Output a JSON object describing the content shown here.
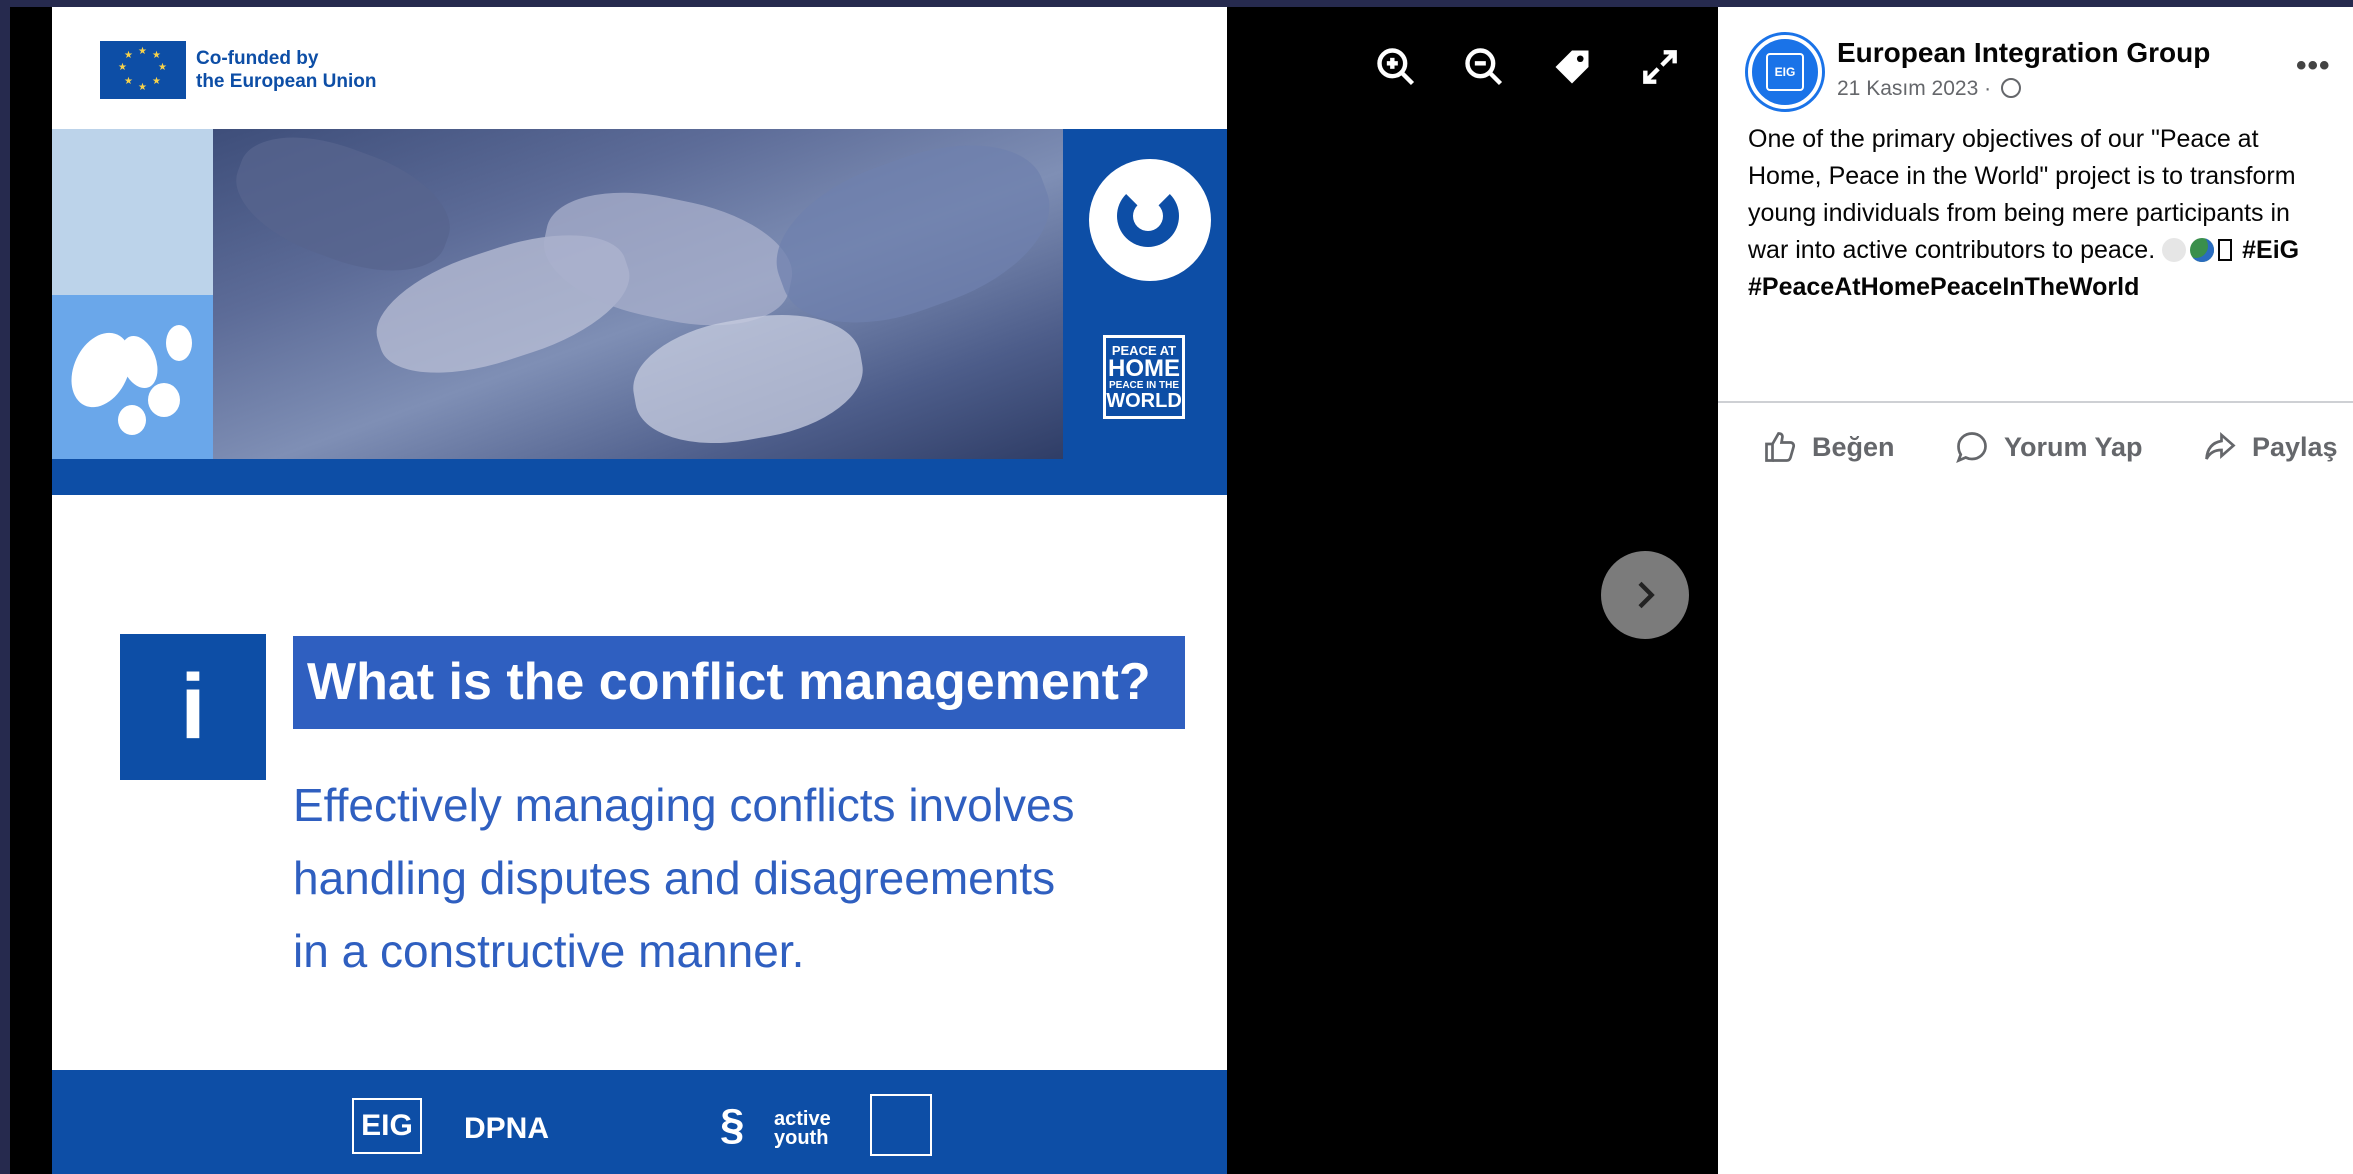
{
  "slide": {
    "eu_label_line1": "Co-funded by",
    "eu_label_line2": "the European Union",
    "peace_logo": [
      "PEACE AT",
      "HOME",
      "PEACE IN THE",
      "WORLD"
    ],
    "info_icon": "i",
    "title": "What is the conflict management?",
    "body_lines": [
      "Effectively managing conflicts involves",
      "handling disputes and disagreements",
      "in a constructive manner."
    ],
    "footer_logos": {
      "eig": "EIG",
      "dpna": "DPNA",
      "active_youth": [
        "active",
        "youth"
      ]
    }
  },
  "viewer": {
    "controls": [
      "zoom-in-icon",
      "zoom-out-icon",
      "tag-icon",
      "fullscreen-icon"
    ],
    "next_icon": "chevron-right-icon"
  },
  "post": {
    "avatar_text": "EIG",
    "page_name": "European Integration Group",
    "date": "21 Kasım 2023 ·",
    "more": "•••",
    "text": "One of the primary objectives of our \"Peace at Home, Peace in the World\" project is to transform young individuals from being mere participants in war into active contributors to peace. ",
    "hashtag1": "#EiG",
    "hashtag2": "#PeaceAtHomePeaceInTheWorld",
    "actions": {
      "like": "Beğen",
      "comment": "Yorum Yap",
      "share": "Paylaş"
    }
  },
  "colors": {
    "brand_blue": "#0d4ea6",
    "title_blue": "#2f5fc0",
    "page_bg": "#262a4e"
  }
}
